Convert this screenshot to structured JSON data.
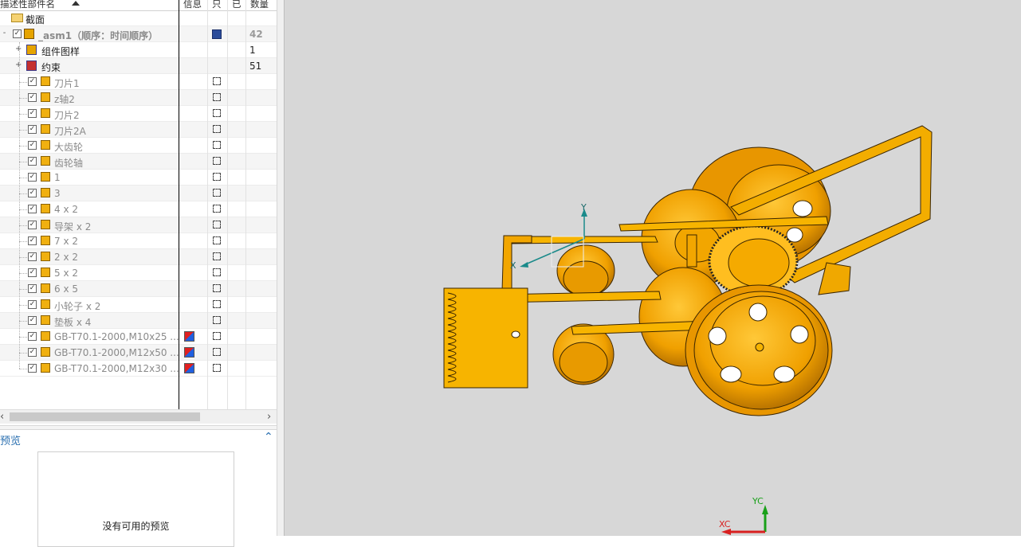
{
  "columns": {
    "name": "描述性部件名",
    "info": "信息",
    "read": "只",
    "edited": "已",
    "count": "数量"
  },
  "rows": [
    {
      "label": "截面",
      "count": "",
      "type": "folder"
    },
    {
      "label": "_asm1（顺序：时间顺序）",
      "count": "42",
      "type": "asm"
    },
    {
      "label": "组件图样",
      "count": "1",
      "type": "pattern"
    },
    {
      "label": "约束",
      "count": "51",
      "type": "constraint"
    },
    {
      "label": "刀片1",
      "count": "",
      "type": "part"
    },
    {
      "label": "z轴2",
      "count": "",
      "type": "part"
    },
    {
      "label": "刀片2",
      "count": "",
      "type": "part"
    },
    {
      "label": "刀片2A",
      "count": "",
      "type": "part"
    },
    {
      "label": "大齿轮",
      "count": "",
      "type": "part"
    },
    {
      "label": "齿轮轴",
      "count": "",
      "type": "part"
    },
    {
      "label": "1",
      "count": "",
      "type": "part"
    },
    {
      "label": "3",
      "count": "",
      "type": "part"
    },
    {
      "label": "4 x 2",
      "count": "",
      "type": "part"
    },
    {
      "label": "导架 x 2",
      "count": "",
      "type": "part"
    },
    {
      "label": "7 x 2",
      "count": "",
      "type": "part"
    },
    {
      "label": "2 x 2",
      "count": "",
      "type": "part"
    },
    {
      "label": "5 x 2",
      "count": "",
      "type": "part"
    },
    {
      "label": "6 x 5",
      "count": "",
      "type": "part"
    },
    {
      "label": "小轮子 x 2",
      "count": "",
      "type": "part"
    },
    {
      "label": "垫板 x 4",
      "count": "",
      "type": "part"
    },
    {
      "label": "GB-T70.1-2000,M10x25 ...",
      "count": "",
      "type": "std"
    },
    {
      "label": "GB-T70.1-2000,M12x50 ...",
      "count": "",
      "type": "std"
    },
    {
      "label": "GB-T70.1-2000,M12x30 ...",
      "count": "",
      "type": "std"
    }
  ],
  "preview": {
    "title": "预览",
    "empty": "没有可用的预览"
  },
  "viewport": {
    "axis_x": "X",
    "axis_y": "Y",
    "triad_x": "XC",
    "triad_y": "YC"
  },
  "colors": {
    "part": "#f0a800",
    "accent": "#2a6fb0",
    "viewport_bg": "#d7d7d7"
  }
}
